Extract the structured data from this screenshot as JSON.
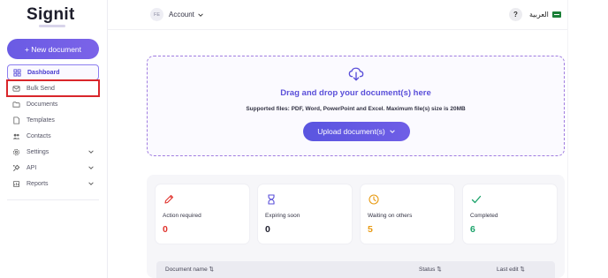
{
  "brand": {
    "name": "Signit"
  },
  "sidebar": {
    "new_document": "+ New document",
    "items": [
      {
        "label": "Dashboard",
        "icon": "dashboard-icon"
      },
      {
        "label": "Bulk Send",
        "icon": "bulk-send-icon"
      },
      {
        "label": "Documents",
        "icon": "documents-icon"
      },
      {
        "label": "Templates",
        "icon": "templates-icon"
      },
      {
        "label": "Contacts",
        "icon": "contacts-icon"
      },
      {
        "label": "Settings",
        "icon": "gear-icon"
      },
      {
        "label": "API",
        "icon": "api-icon"
      },
      {
        "label": "Reports",
        "icon": "reports-icon"
      }
    ]
  },
  "header": {
    "avatar_initials": "FE",
    "account_label": "Account",
    "help_label": "?",
    "language_label": "العربية"
  },
  "upload": {
    "title": "Drag and drop your document(s) here",
    "subtitle": "Supported files: PDF, Word, PowerPoint and Excel. Maximum file(s) size is 20MB",
    "button_label": "Upload document(s)"
  },
  "stats": [
    {
      "label": "Action required",
      "value": "0",
      "color": "#e0322c"
    },
    {
      "label": "Expiring soon",
      "value": "0",
      "color": "#222230"
    },
    {
      "label": "Waiting on others",
      "value": "5",
      "color": "#e89a12"
    },
    {
      "label": "Completed",
      "value": "6",
      "color": "#1ba36a"
    }
  ],
  "table": {
    "columns": [
      "Document name ⇅",
      "Status ⇅",
      "Last edit ⇅"
    ]
  },
  "colors": {
    "accent": "#6a5be4",
    "highlight_box": "#d9262b"
  }
}
